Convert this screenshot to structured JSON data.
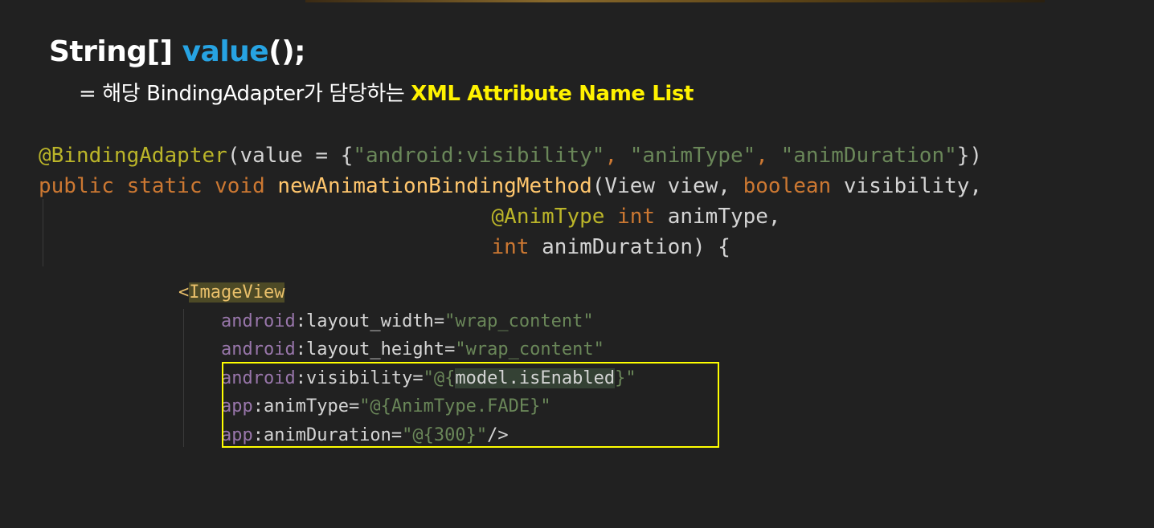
{
  "heading": {
    "prefix": "String[] ",
    "method": "value",
    "suffix": "();"
  },
  "subheading": {
    "text": "= 해당 BindingAdapter가 담당하는 ",
    "highlight": "XML Attribute Name List"
  },
  "java_code": {
    "line1": {
      "annotation": "@BindingAdapter",
      "open": "(value = {",
      "str1": "\"android:visibility\"",
      "sep1": ", ",
      "str2": "\"animType\"",
      "sep2": ", ",
      "str3": "\"animDuration\"",
      "close": "})"
    },
    "line2": {
      "modifiers": "public static void ",
      "method": "newAnimationBindingMethod",
      "params": "(View view, ",
      "bool_kw": "boolean",
      "param_end": " visibility,"
    },
    "line3": {
      "indent": "                                    ",
      "annotation": "@AnimType",
      "int_kw": " int",
      "param": " animType,"
    },
    "line4": {
      "indent": "                                    ",
      "int_kw": "int",
      "param": " animDuration) {"
    }
  },
  "xml_code": {
    "tag_open": "<",
    "tag_name": "ImageView",
    "lines": [
      {
        "indent": "    ",
        "ns": "android",
        "attr": ":layout_width=",
        "q1": "\"",
        "value": "wrap_content",
        "q2": "\""
      },
      {
        "indent": "    ",
        "ns": "android",
        "attr": ":layout_height=",
        "q1": "\"",
        "value": "wrap_content",
        "q2": "\""
      },
      {
        "indent": "    ",
        "ns": "android",
        "attr": ":visibility=",
        "q1": "\"@{",
        "value": "model.isEnabled",
        "q2": "}\""
      },
      {
        "indent": "    ",
        "ns": "app",
        "attr": ":animType=",
        "q1": "\"@{",
        "value": "AnimType.FADE",
        "q2": "}\""
      },
      {
        "indent": "    ",
        "ns": "app",
        "attr": ":animDuration=",
        "q1": "\"@{",
        "value": "300",
        "q2": "}\""
      }
    ],
    "tag_close": "/>"
  },
  "colors": {
    "background": "#212121",
    "heading_accent": "#27a3e2",
    "subheading_highlight": "#fff200",
    "box_border": "#ffff00",
    "annotation": "#bbb529",
    "keyword": "#cc7832",
    "string": "#6a8759",
    "method": "#ffc66d",
    "namespace": "#9876aa"
  }
}
